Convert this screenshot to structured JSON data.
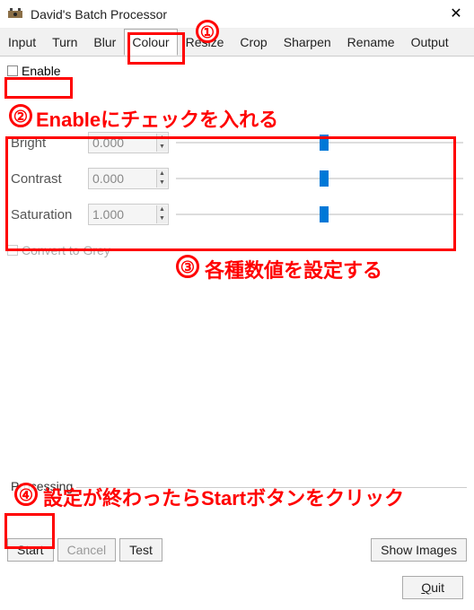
{
  "window": {
    "title": "David's Batch Processor"
  },
  "tabs": {
    "items": [
      "Input",
      "Turn",
      "Blur",
      "Colour",
      "Resize",
      "Crop",
      "Sharpen",
      "Rename",
      "Output"
    ],
    "active": "Colour"
  },
  "enable": {
    "label": "Enable",
    "checked": false
  },
  "params": {
    "bright": {
      "label": "Bright",
      "value": "0.000",
      "slider_pos": 0.5
    },
    "contrast": {
      "label": "Contrast",
      "value": "0.000",
      "slider_pos": 0.5
    },
    "saturation": {
      "label": "Saturation",
      "value": "1.000",
      "slider_pos": 0.5
    }
  },
  "convert_grey": {
    "label": "Convert to Grey",
    "checked": false,
    "enabled": false
  },
  "processing": {
    "label": "Processing",
    "start": "Start",
    "cancel": "Cancel",
    "test": "Test",
    "show_images": "Show Images"
  },
  "quit": {
    "label": "Quit",
    "accel": "Q"
  },
  "annotations": {
    "n1": "①",
    "n2": "②",
    "n3": "③",
    "n4": "④",
    "t2": "Enableにチェックを入れる",
    "t3": "各種数値を設定する",
    "t4": "設定が終わったらStartボタンをクリック"
  }
}
